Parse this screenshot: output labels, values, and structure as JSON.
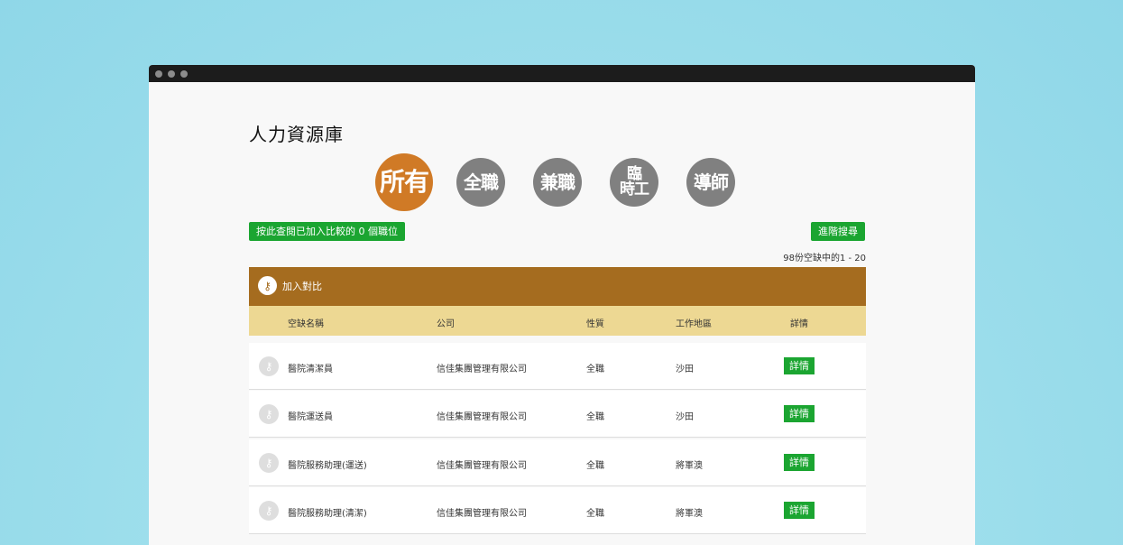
{
  "page": {
    "title": "人力資源庫"
  },
  "categories": [
    {
      "label": "所有",
      "active": true
    },
    {
      "label": "全職",
      "active": false
    },
    {
      "label": "兼職",
      "active": false
    },
    {
      "label_line1": "臨",
      "label_line2": "時工",
      "active": false
    },
    {
      "label": "導師",
      "active": false
    }
  ],
  "toolbar": {
    "compare_label": "按此查閱已加入比較的 0 個職位",
    "advanced_search_label": "進階搜尋",
    "result_count": "98份空缺中的1 - 20"
  },
  "table": {
    "add_compare_label": "加入對比",
    "columns": [
      "空缺名稱",
      "公司",
      "性質",
      "工作地區",
      "詳情"
    ],
    "rows": [
      {
        "title": "醫院清潔員",
        "company": "信佳集團管理有限公司",
        "type": "全職",
        "area": "沙田",
        "detail": "詳情"
      },
      {
        "title": "醫院運送員",
        "company": "信佳集團管理有限公司",
        "type": "全職",
        "area": "沙田",
        "detail": "詳情"
      },
      {
        "title": "醫院服務助理(運送)",
        "company": "信佳集團管理有限公司",
        "type": "全職",
        "area": "將軍澳",
        "detail": "詳情"
      },
      {
        "title": "醫院服務助理(清潔)",
        "company": "信佳集團管理有限公司",
        "type": "全職",
        "area": "將軍澳",
        "detail": "詳情"
      }
    ]
  },
  "colors": {
    "accent": "#d07a26",
    "header_brown": "#a56c1f",
    "header_yellow": "#edd893",
    "green": "#1ba531",
    "inactive": "#808080"
  }
}
